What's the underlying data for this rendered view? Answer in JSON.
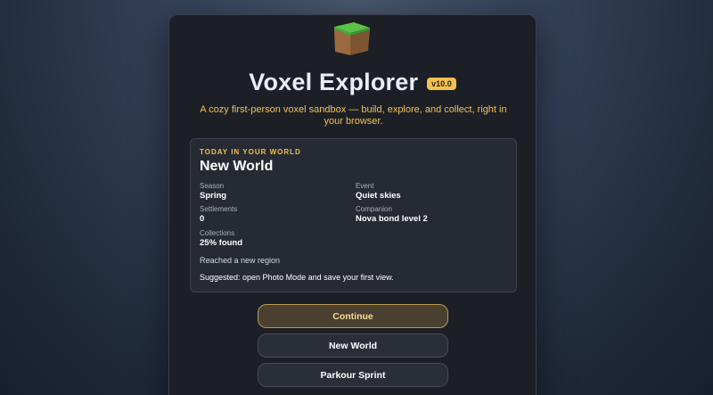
{
  "app": {
    "title": "Voxel Explorer",
    "version": "v10.0",
    "tagline": "A cozy first-person voxel sandbox — build, explore, and collect, right in your browser.",
    "logo_icon": "grass-block-icon"
  },
  "world_card": {
    "kicker": "TODAY IN YOUR WORLD",
    "world_name": "New World",
    "stats": [
      {
        "label": "Season",
        "value": "Spring"
      },
      {
        "label": "Event",
        "value": "Quiet skies"
      },
      {
        "label": "Settlements",
        "value": "0"
      },
      {
        "label": "Companion",
        "value": "Nova bond level 2"
      },
      {
        "label": "Collections",
        "value": "25% found"
      }
    ],
    "note": "Reached a new region",
    "suggestion": "Suggested: open Photo Mode and save your first view."
  },
  "menu": {
    "continue_label": "Continue",
    "new_world_label": "New World",
    "parkour_label": "Parkour Sprint"
  },
  "colors": {
    "accent": "#f2c14e",
    "panel": "#1c1f26",
    "card": "#262a33"
  }
}
